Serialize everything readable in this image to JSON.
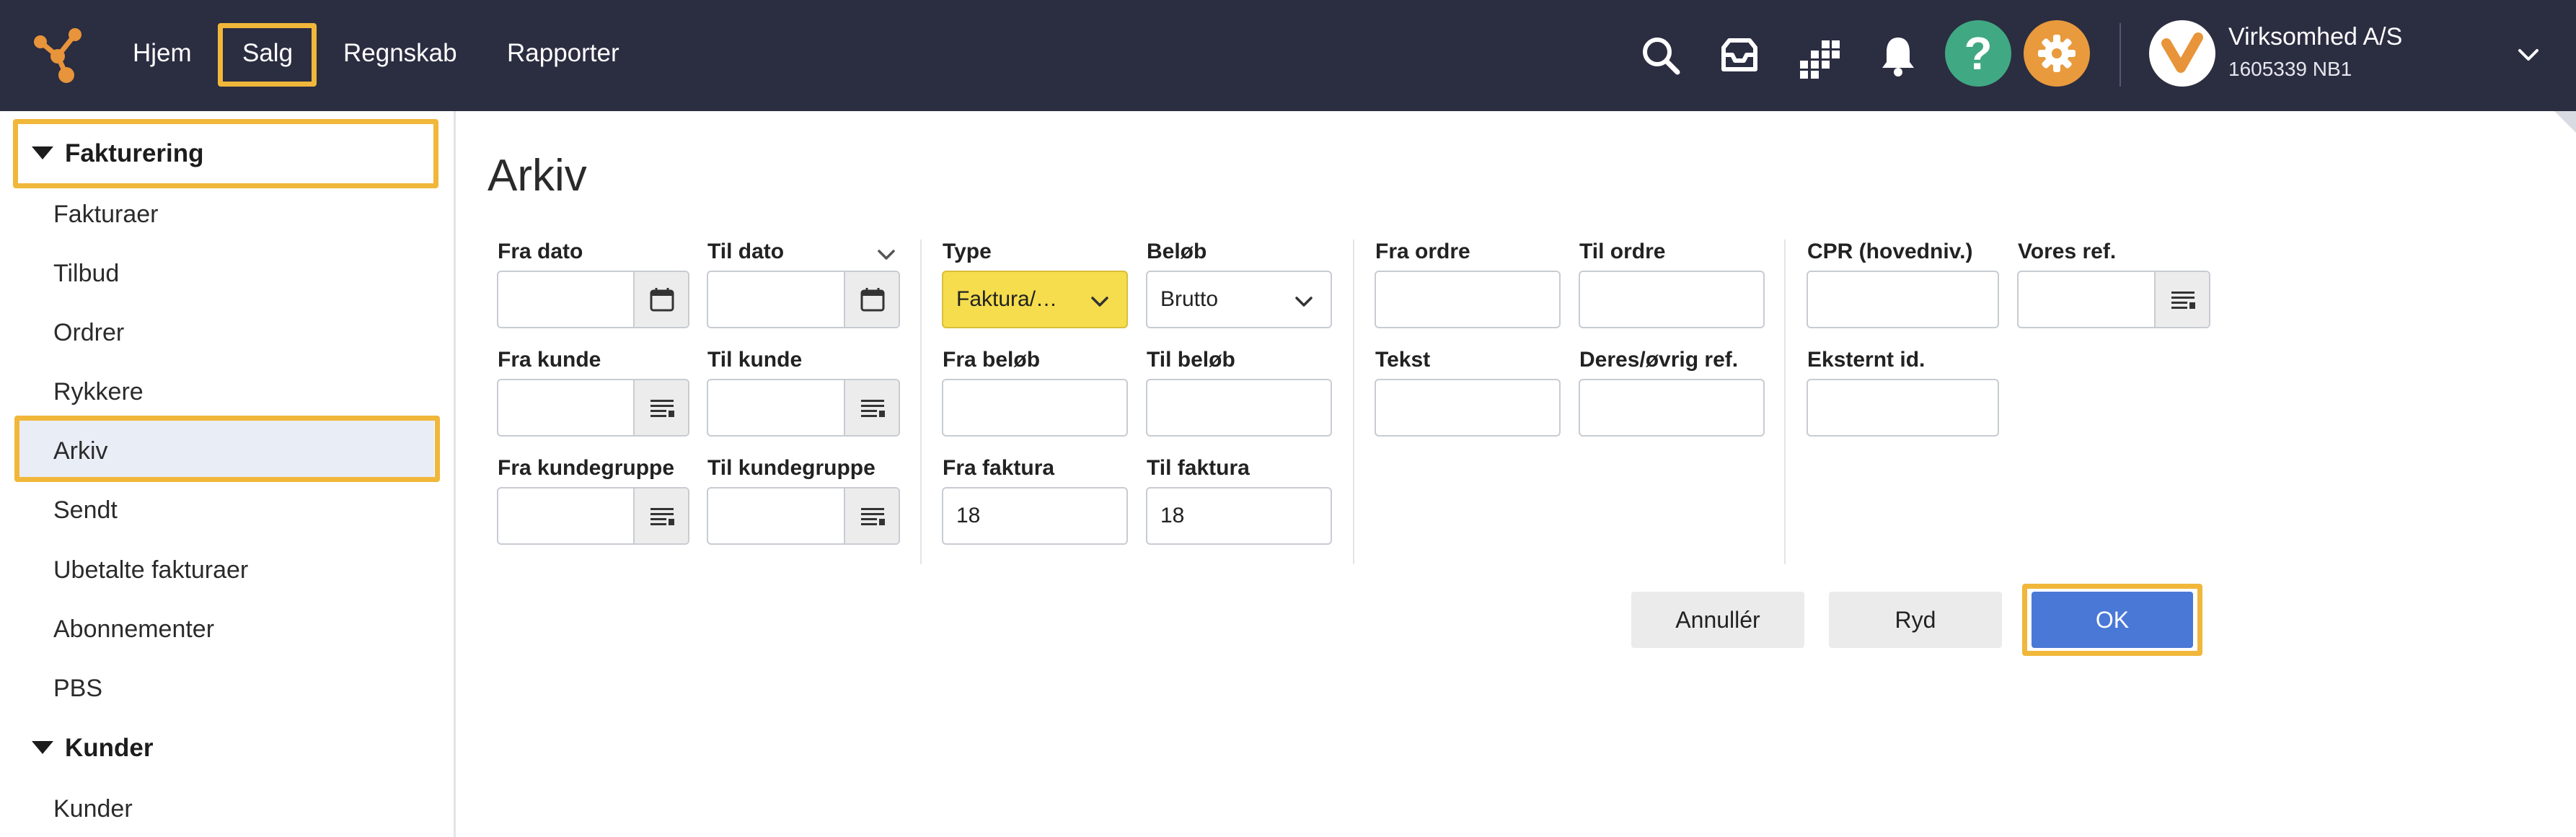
{
  "nav": {
    "items": [
      {
        "label": "Hjem"
      },
      {
        "label": "Salg"
      },
      {
        "label": "Regnskab"
      },
      {
        "label": "Rapporter"
      }
    ]
  },
  "header": {
    "help_symbol": "?",
    "company_name": "Virksomhed A/S",
    "company_id": "1605339 NB1",
    "icons": [
      "search-icon",
      "inbox-icon",
      "apps-grid-icon",
      "bell-icon",
      "help-icon",
      "gear-icon",
      "user-avatar",
      "chevron-down-icon"
    ],
    "colors": {
      "bar": "#2b2d41",
      "help": "#40a883",
      "gear": "#e89a3c",
      "highlight": "#f0b73a"
    }
  },
  "sidebar": {
    "group1": "Fakturering",
    "items": [
      {
        "label": "Fakturaer"
      },
      {
        "label": "Tilbud"
      },
      {
        "label": "Ordrer"
      },
      {
        "label": "Rykkere"
      },
      {
        "label": "Arkiv"
      },
      {
        "label": "Sendt"
      },
      {
        "label": "Ubetalte fakturaer"
      },
      {
        "label": "Abonnementer"
      },
      {
        "label": "PBS"
      }
    ],
    "group2": "Kunder",
    "items2": [
      {
        "label": "Kunder"
      }
    ]
  },
  "main": {
    "title": "Arkiv",
    "fields": {
      "fra_dato": {
        "label": "Fra dato",
        "value": ""
      },
      "til_dato": {
        "label": "Til dato",
        "value": ""
      },
      "fra_kunde": {
        "label": "Fra kunde",
        "value": ""
      },
      "til_kunde": {
        "label": "Til kunde",
        "value": ""
      },
      "fra_kundegruppe": {
        "label": "Fra kundegruppe",
        "value": ""
      },
      "til_kundegruppe": {
        "label": "Til kundegruppe",
        "value": ""
      },
      "type": {
        "label": "Type",
        "value": "Faktura/…"
      },
      "belob": {
        "label": "Beløb",
        "value": "Brutto"
      },
      "fra_belob": {
        "label": "Fra beløb",
        "value": ""
      },
      "til_belob": {
        "label": "Til beløb",
        "value": ""
      },
      "fra_faktura": {
        "label": "Fra faktura",
        "value": "18"
      },
      "til_faktura": {
        "label": "Til faktura",
        "value": "18"
      },
      "fra_ordre": {
        "label": "Fra ordre",
        "value": ""
      },
      "til_ordre": {
        "label": "Til ordre",
        "value": ""
      },
      "tekst": {
        "label": "Tekst",
        "value": ""
      },
      "deres_ref": {
        "label": "Deres/øvrig ref.",
        "value": ""
      },
      "cpr": {
        "label": "CPR (hovedniv.)",
        "value": ""
      },
      "vores_ref": {
        "label": "Vores ref.",
        "value": ""
      },
      "eksternt_id": {
        "label": "Eksternt id.",
        "value": ""
      }
    },
    "buttons": {
      "cancel": "Annullér",
      "clear": "Ryd",
      "ok": "OK"
    },
    "colors": {
      "type_field": "#f5dd4d",
      "ok_button": "#4a78d6"
    }
  }
}
